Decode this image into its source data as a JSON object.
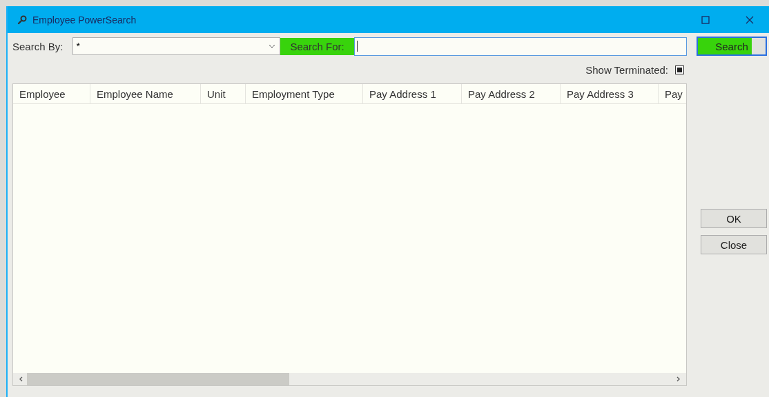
{
  "window": {
    "title": "Employee PowerSearch"
  },
  "search_by": {
    "label": "Search By:",
    "value": "*"
  },
  "search_for": {
    "label": "Search For:",
    "highlighted": true
  },
  "search_button": {
    "label": "Search",
    "highlighted": true
  },
  "show_terminated": {
    "label": "Show Terminated:",
    "checked": true
  },
  "table": {
    "columns": [
      "Employee",
      "Employee Name",
      "Unit",
      "Employment Type",
      "Pay Address 1",
      "Pay Address 2",
      "Pay Address 3",
      "Pay"
    ]
  },
  "buttons": [
    "OK",
    "Close"
  ]
}
